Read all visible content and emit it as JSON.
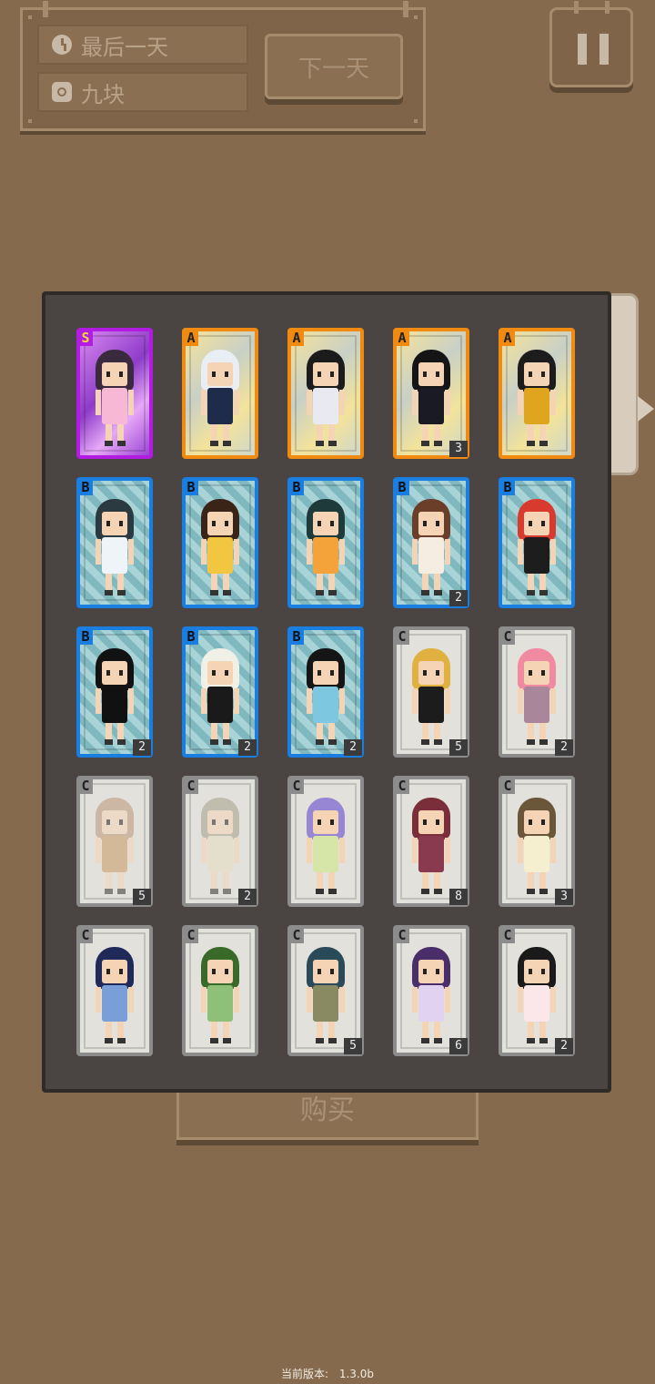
{
  "hud": {
    "day_label": "最后一天",
    "money_label": "九块",
    "next_day_label": "下一天",
    "buy_label": "购买"
  },
  "icons": {
    "day": "clock-icon",
    "money": "coin-icon",
    "pause": "pause-icon"
  },
  "cards": [
    {
      "rank": "S",
      "count": "",
      "hair": "#3a2a3e",
      "outfit": "#f7b8d6"
    },
    {
      "rank": "A",
      "count": "",
      "hair": "#e8eef4",
      "outfit": "#1f2b4a"
    },
    {
      "rank": "A",
      "count": "",
      "hair": "#1b1b1b",
      "outfit": "#e9e9f2"
    },
    {
      "rank": "A",
      "count": "3",
      "hair": "#151515",
      "outfit": "#1a1a24"
    },
    {
      "rank": "A",
      "count": "",
      "hair": "#1c1c1c",
      "outfit": "#e0a51e"
    },
    {
      "rank": "B",
      "count": "",
      "hair": "#2b3a40",
      "outfit": "#eef4f8"
    },
    {
      "rank": "B",
      "count": "",
      "hair": "#3a2418",
      "outfit": "#f2c640"
    },
    {
      "rank": "B",
      "count": "",
      "hair": "#1f3a3a",
      "outfit": "#f3a33a"
    },
    {
      "rank": "B",
      "count": "2",
      "hair": "#6a3e28",
      "outfit": "#f5ede2"
    },
    {
      "rank": "B",
      "count": "",
      "hair": "#d83b2d",
      "outfit": "#1d1d1d"
    },
    {
      "rank": "B",
      "count": "2",
      "hair": "#121212",
      "outfit": "#111111"
    },
    {
      "rank": "B",
      "count": "2",
      "hair": "#f1f0e6",
      "outfit": "#1a1a1a"
    },
    {
      "rank": "B",
      "count": "2",
      "hair": "#151515",
      "outfit": "#7ec7e0"
    },
    {
      "rank": "C",
      "count": "5",
      "hair": "#e0b040",
      "outfit": "#1c1c1c"
    },
    {
      "rank": "C",
      "count": "2",
      "hair": "#f08aa0",
      "outfit": "#a9869a"
    },
    {
      "rank": "C",
      "count": "5",
      "hair": "#b89675",
      "outfit": "#c79a62"
    },
    {
      "rank": "C",
      "count": "2",
      "hair": "#a5a08a",
      "outfit": "#e6dcc0"
    },
    {
      "rank": "C",
      "count": "",
      "hair": "#9686d4",
      "outfit": "#d6e6a8"
    },
    {
      "rank": "C",
      "count": "8",
      "hair": "#7a2e3a",
      "outfit": "#8a3a4e"
    },
    {
      "rank": "C",
      "count": "3",
      "hair": "#6a5638",
      "outfit": "#f5efcf"
    },
    {
      "rank": "C",
      "count": "",
      "hair": "#1f2a5a",
      "outfit": "#7a9fd8"
    },
    {
      "rank": "C",
      "count": "",
      "hair": "#3a6a2a",
      "outfit": "#8fc07a"
    },
    {
      "rank": "C",
      "count": "5",
      "hair": "#2a4a5a",
      "outfit": "#8a8a62"
    },
    {
      "rank": "C",
      "count": "6",
      "hair": "#4a2e6a",
      "outfit": "#e2d2f2"
    },
    {
      "rank": "C",
      "count": "2",
      "hair": "#1a1a1a",
      "outfit": "#fbe7ea"
    }
  ],
  "version": {
    "label": "当前版本:",
    "value": "1.3.0b"
  }
}
